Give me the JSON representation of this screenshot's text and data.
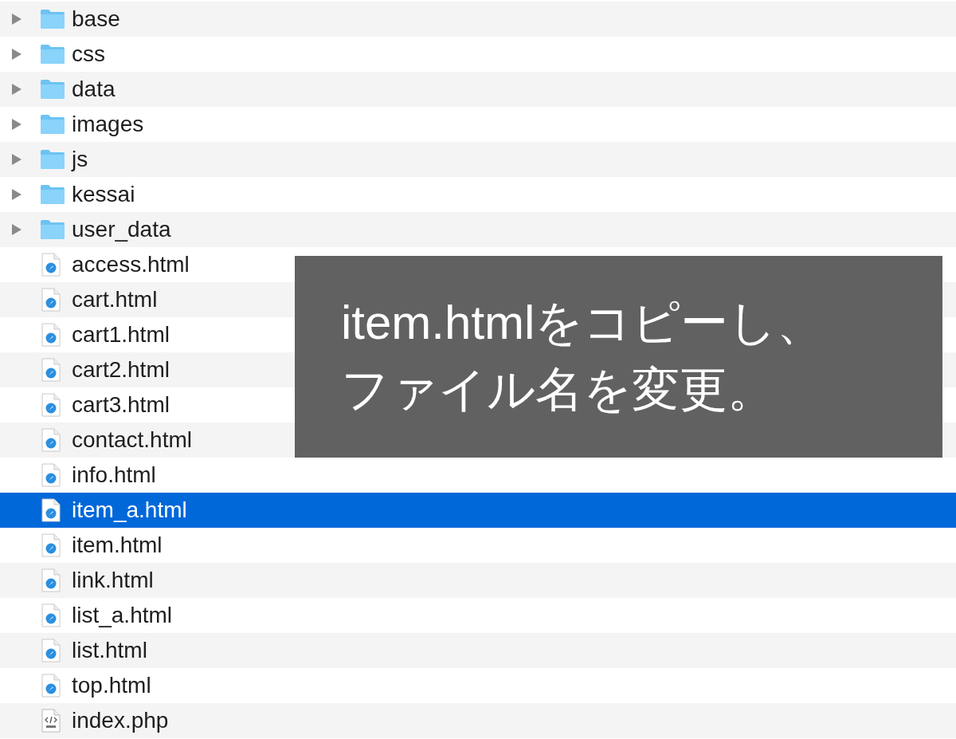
{
  "files": [
    {
      "name": "base",
      "kind": "folder",
      "expanded": false,
      "selected": false
    },
    {
      "name": "css",
      "kind": "folder",
      "expanded": false,
      "selected": false
    },
    {
      "name": "data",
      "kind": "folder",
      "expanded": false,
      "selected": false
    },
    {
      "name": "images",
      "kind": "folder",
      "expanded": false,
      "selected": false
    },
    {
      "name": "js",
      "kind": "folder",
      "expanded": false,
      "selected": false
    },
    {
      "name": "kessai",
      "kind": "folder",
      "expanded": false,
      "selected": false
    },
    {
      "name": "user_data",
      "kind": "folder",
      "expanded": false,
      "selected": false
    },
    {
      "name": "access.html",
      "kind": "html",
      "selected": false
    },
    {
      "name": "cart.html",
      "kind": "html",
      "selected": false
    },
    {
      "name": "cart1.html",
      "kind": "html",
      "selected": false
    },
    {
      "name": "cart2.html",
      "kind": "html",
      "selected": false
    },
    {
      "name": "cart3.html",
      "kind": "html",
      "selected": false
    },
    {
      "name": "contact.html",
      "kind": "html",
      "selected": false
    },
    {
      "name": "info.html",
      "kind": "html",
      "selected": false
    },
    {
      "name": "item_a.html",
      "kind": "html",
      "selected": true
    },
    {
      "name": "item.html",
      "kind": "html",
      "selected": false
    },
    {
      "name": "link.html",
      "kind": "html",
      "selected": false
    },
    {
      "name": "list_a.html",
      "kind": "html",
      "selected": false
    },
    {
      "name": "list.html",
      "kind": "html",
      "selected": false
    },
    {
      "name": "top.html",
      "kind": "html",
      "selected": false
    },
    {
      "name": "index.php",
      "kind": "php",
      "selected": false
    }
  ],
  "caption": [
    "item.htmlをコピーし、",
    "ファイル名を変更。"
  ]
}
